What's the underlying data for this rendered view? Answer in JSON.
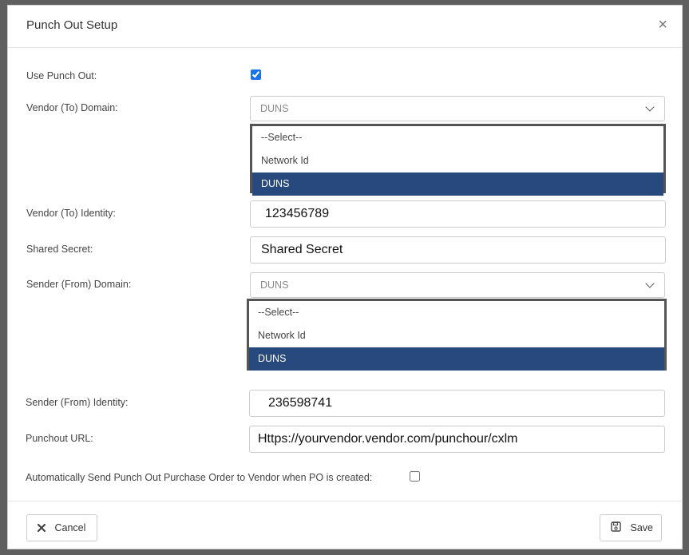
{
  "dialog": {
    "title": "Punch Out Setup",
    "close_symbol": "×"
  },
  "fields": {
    "use_punch_out": {
      "label": "Use Punch Out:",
      "checked": true
    },
    "vendor_domain": {
      "label": "Vendor (To) Domain:",
      "value": "DUNS",
      "options": [
        "--Select--",
        "Network Id",
        "DUNS"
      ],
      "selected": "DUNS"
    },
    "vendor_identity": {
      "label": "Vendor (To) Identity:",
      "value": "123456789"
    },
    "shared_secret": {
      "label": "Shared Secret:",
      "value": "Shared Secret"
    },
    "sender_domain": {
      "label": "Sender (From) Domain:",
      "value": "DUNS",
      "options": [
        "--Select--",
        "Network Id",
        "DUNS"
      ],
      "selected": "DUNS"
    },
    "sender_identity": {
      "label": "Sender (From) Identity:",
      "value": "236598741"
    },
    "punchout_url": {
      "label": "Punchout URL:",
      "value": "Https://yourvendor.vendor.com/punchour/cxlm"
    },
    "auto_send": {
      "label": "Automatically Send Punch Out Purchase Order to Vendor when PO is created:",
      "checked": false
    }
  },
  "footer": {
    "cancel_label": "Cancel",
    "save_label": "Save"
  },
  "icons": {
    "cancel": "x-icon",
    "save": "floppy-disk-icon"
  },
  "colors": {
    "selected_option_bg": "#27497d",
    "checkbox_accent": "#1a73e8"
  }
}
